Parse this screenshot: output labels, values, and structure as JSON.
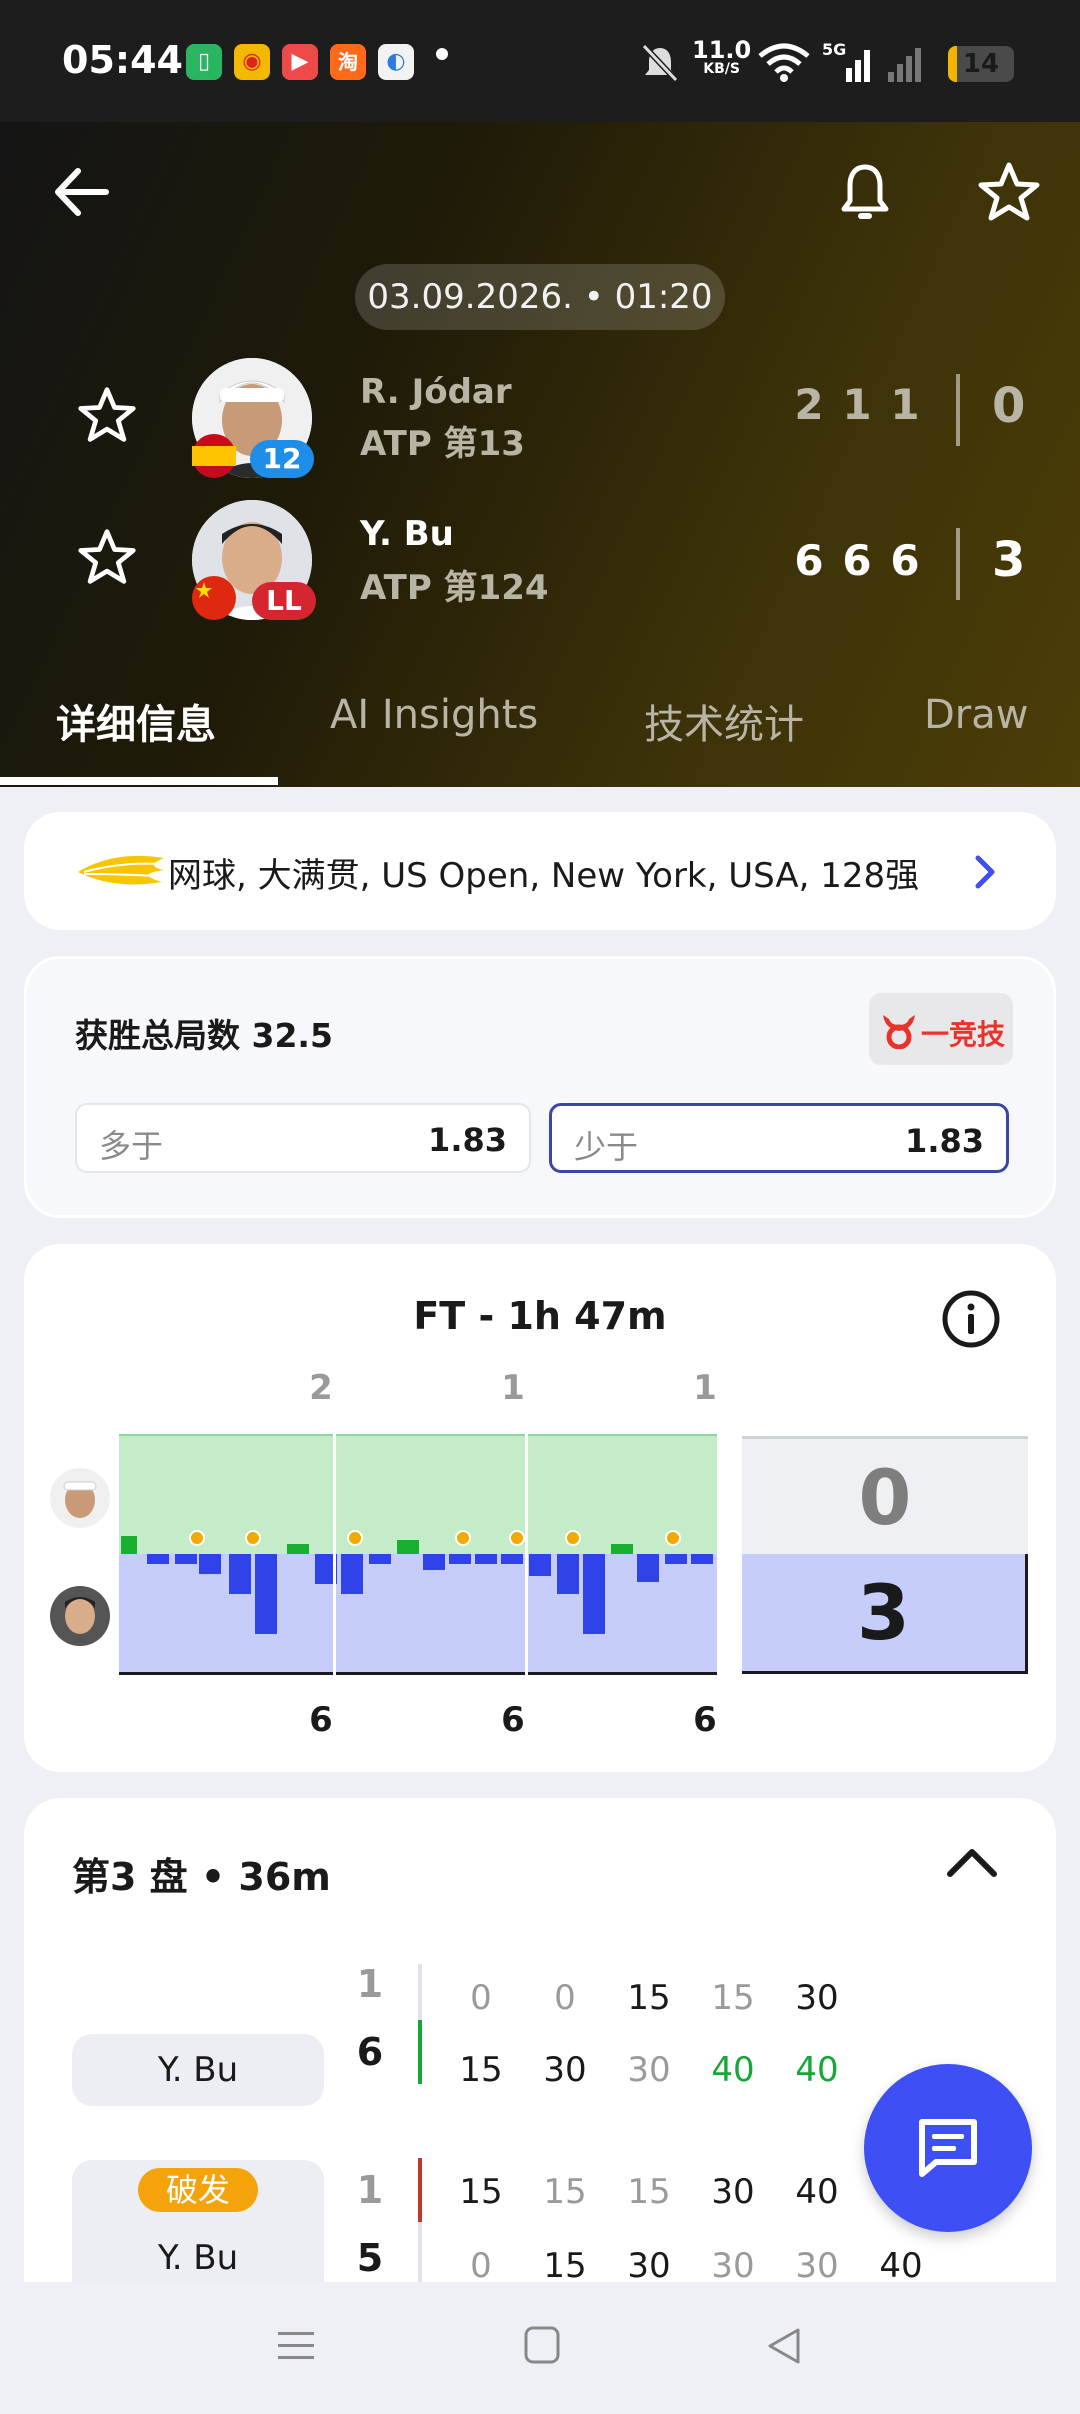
{
  "status_bar": {
    "time": "05:44",
    "speed_value": "11.0",
    "speed_unit": "KB/S",
    "network": "5G",
    "battery_level": "14",
    "app_icons": [
      "taobao-icon",
      "weibo-icon",
      "video-icon",
      "taobao-shop-icon",
      "browser-icon"
    ]
  },
  "header": {
    "date": "03.09.2026. • 01:20",
    "player1": {
      "name": "R. Jódar",
      "rank": "ATP 第13",
      "seed": "12",
      "sets": [
        "2",
        "1",
        "1"
      ],
      "total": "0"
    },
    "player2": {
      "name": "Y. Bu",
      "rank": "ATP 第124",
      "seed": "LL",
      "sets": [
        "6",
        "6",
        "6"
      ],
      "total": "3"
    }
  },
  "tabs": [
    "详细信息",
    "AI Insights",
    "技术统计",
    "Draw"
  ],
  "tournament": {
    "text": "网球, 大满贯, US Open, New York, USA, 128强"
  },
  "odds": {
    "title": "获胜总局数 32.5",
    "sponsor": "一竞技",
    "over_label": "多于",
    "over_value": "1.83",
    "under_label": "少于",
    "under_value": "1.83"
  },
  "momentum": {
    "title": "FT - 1h 47m",
    "set_totals_top": [
      "2",
      "1",
      "1"
    ],
    "set_totals_bottom": [
      "6",
      "6",
      "6"
    ],
    "score_top": "0",
    "score_bottom": "3"
  },
  "set_detail": {
    "title": "第3 盘 • 36m",
    "rows": [
      {
        "top_game": "1",
        "top_points": [
          "0",
          "0",
          "15",
          "15",
          "30"
        ],
        "player": "Y. Bu",
        "bottom_game": "6",
        "bottom_points": [
          "15",
          "30",
          "30",
          "40",
          "40"
        ]
      },
      {
        "badge": "破发",
        "top_game": "1",
        "top_points": [
          "15",
          "15",
          "15",
          "30",
          "40"
        ],
        "player": "Y. Bu",
        "bottom_game": "5",
        "bottom_points": [
          "0",
          "15",
          "30",
          "30",
          "30",
          "40"
        ]
      }
    ]
  },
  "colors": {
    "accent": "#3d4ff5",
    "win_green": "#16a836",
    "chart_green": "#c4ecc9",
    "chart_blue": "#c6cdfa"
  }
}
